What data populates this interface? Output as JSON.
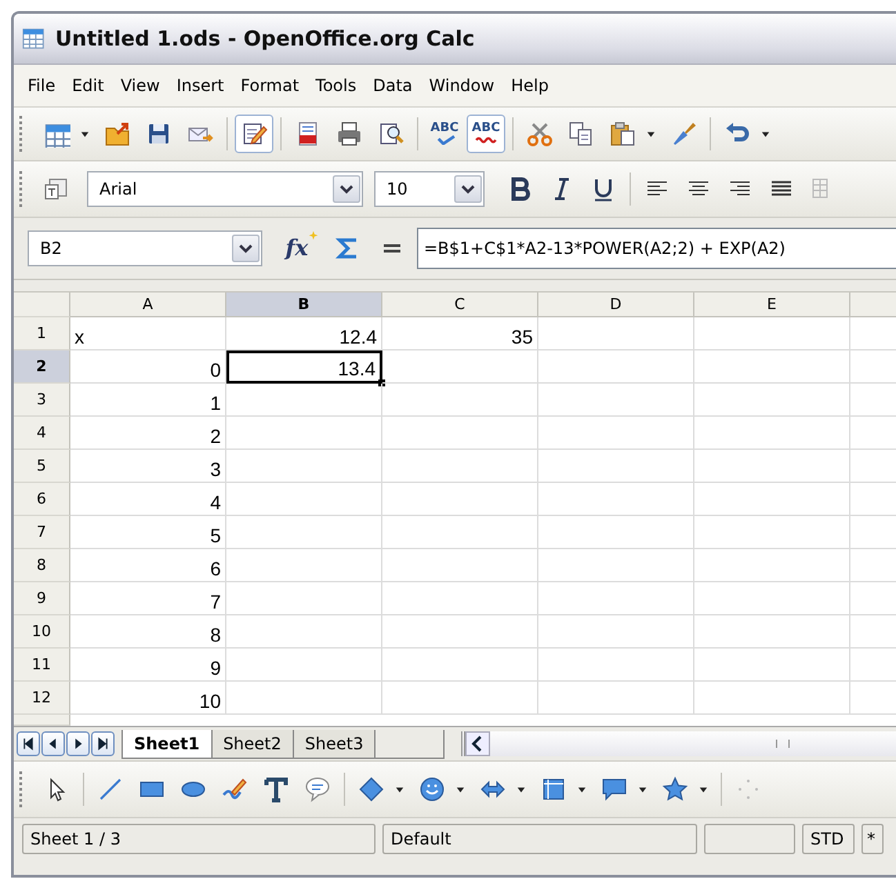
{
  "window": {
    "title": "Untitled 1.ods - OpenOffice.org Calc"
  },
  "menu": [
    "File",
    "Edit",
    "View",
    "Insert",
    "Format",
    "Tools",
    "Data",
    "Window",
    "Help"
  ],
  "toggles": {
    "edit_mode": true,
    "auto_spellcheck": true
  },
  "icon_labels": {
    "spellcheck": "ABC",
    "auto_spellcheck": "ABC",
    "function_wizard": "fx"
  },
  "formatting": {
    "font": "Arial",
    "size": "10"
  },
  "formula_bar": {
    "name_box": "B2",
    "formula": "=B$1+C$1*A2-13*POWER(A2;2) + EXP(A2)"
  },
  "columns": [
    {
      "label": "A",
      "selected": false
    },
    {
      "label": "B",
      "selected": true
    },
    {
      "label": "C",
      "selected": false
    },
    {
      "label": "D",
      "selected": false
    },
    {
      "label": "E",
      "selected": false
    }
  ],
  "rows": [
    {
      "label": "1",
      "selected": false,
      "cells": [
        {
          "text": "x",
          "kind": "text",
          "selected": false
        },
        {
          "text": "12.4",
          "kind": "number",
          "selected": false
        },
        {
          "text": "35",
          "kind": "number",
          "selected": false
        },
        {
          "selected": false
        },
        {
          "selected": false
        }
      ]
    },
    {
      "label": "2",
      "selected": true,
      "cells": [
        {
          "text": "0",
          "kind": "number",
          "selected": false
        },
        {
          "text": "13.4",
          "kind": "number",
          "selected": true
        },
        {
          "selected": false
        },
        {
          "selected": false
        },
        {
          "selected": false
        }
      ]
    },
    {
      "label": "3",
      "selected": false,
      "cells": [
        {
          "text": "1",
          "kind": "number",
          "selected": false
        },
        {
          "selected": false
        },
        {
          "selected": false
        },
        {
          "selected": false
        },
        {
          "selected": false
        }
      ]
    },
    {
      "label": "4",
      "selected": false,
      "cells": [
        {
          "text": "2",
          "kind": "number",
          "selected": false
        },
        {
          "selected": false
        },
        {
          "selected": false
        },
        {
          "selected": false
        },
        {
          "selected": false
        }
      ]
    },
    {
      "label": "5",
      "selected": false,
      "cells": [
        {
          "text": "3",
          "kind": "number",
          "selected": false
        },
        {
          "selected": false
        },
        {
          "selected": false
        },
        {
          "selected": false
        },
        {
          "selected": false
        }
      ]
    },
    {
      "label": "6",
      "selected": false,
      "cells": [
        {
          "text": "4",
          "kind": "number",
          "selected": false
        },
        {
          "selected": false
        },
        {
          "selected": false
        },
        {
          "selected": false
        },
        {
          "selected": false
        }
      ]
    },
    {
      "label": "7",
      "selected": false,
      "cells": [
        {
          "text": "5",
          "kind": "number",
          "selected": false
        },
        {
          "selected": false
        },
        {
          "selected": false
        },
        {
          "selected": false
        },
        {
          "selected": false
        }
      ]
    },
    {
      "label": "8",
      "selected": false,
      "cells": [
        {
          "text": "6",
          "kind": "number",
          "selected": false
        },
        {
          "selected": false
        },
        {
          "selected": false
        },
        {
          "selected": false
        },
        {
          "selected": false
        }
      ]
    },
    {
      "label": "9",
      "selected": false,
      "cells": [
        {
          "text": "7",
          "kind": "number",
          "selected": false
        },
        {
          "selected": false
        },
        {
          "selected": false
        },
        {
          "selected": false
        },
        {
          "selected": false
        }
      ]
    },
    {
      "label": "10",
      "selected": false,
      "cells": [
        {
          "text": "8",
          "kind": "number",
          "selected": false
        },
        {
          "selected": false
        },
        {
          "selected": false
        },
        {
          "selected": false
        },
        {
          "selected": false
        }
      ]
    },
    {
      "label": "11",
      "selected": false,
      "cells": [
        {
          "text": "9",
          "kind": "number",
          "selected": false
        },
        {
          "selected": false
        },
        {
          "selected": false
        },
        {
          "selected": false
        },
        {
          "selected": false
        }
      ]
    },
    {
      "label": "12",
      "selected": false,
      "cells": [
        {
          "text": "10",
          "kind": "number",
          "selected": false
        },
        {
          "selected": false
        },
        {
          "selected": false
        },
        {
          "selected": false
        },
        {
          "selected": false
        }
      ]
    }
  ],
  "sheet_tabs": [
    {
      "label": "Sheet1",
      "selected": true
    },
    {
      "label": "Sheet2",
      "selected": false
    },
    {
      "label": "Sheet3",
      "selected": false
    }
  ],
  "status_bar": [
    "Sheet 1 / 3",
    "Default",
    "STD",
    "*"
  ]
}
